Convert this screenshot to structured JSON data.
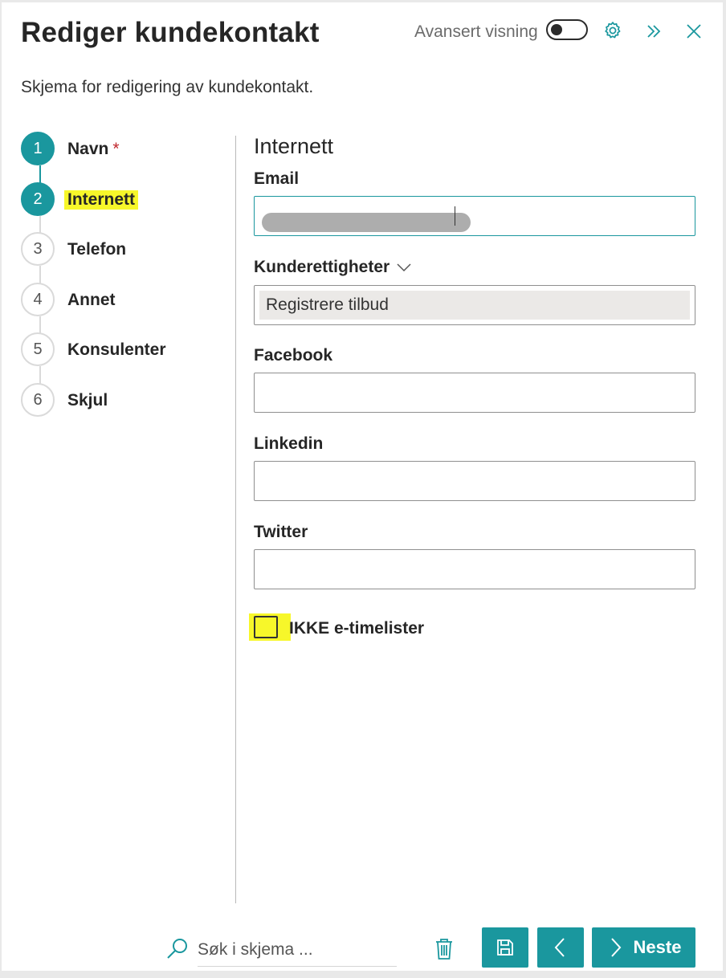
{
  "header": {
    "title": "Rediger kundekontakt",
    "advanced_view_label": "Avansert visning",
    "advanced_view_on": false,
    "subtitle": "Skjema for redigering av kundekontakt."
  },
  "steps": [
    {
      "number": "1",
      "label": "Navn",
      "required_mark": "*",
      "state": "completed"
    },
    {
      "number": "2",
      "label": "Internett",
      "state": "active"
    },
    {
      "number": "3",
      "label": "Telefon",
      "state": "pending"
    },
    {
      "number": "4",
      "label": "Annet",
      "state": "pending"
    },
    {
      "number": "5",
      "label": "Konsulenter",
      "state": "pending"
    },
    {
      "number": "6",
      "label": "Skjul",
      "state": "pending"
    }
  ],
  "form": {
    "section_title": "Internett",
    "email": {
      "label": "Email",
      "value": ""
    },
    "rights": {
      "label": "Kunderettigheter",
      "selected": "Registrere tilbud"
    },
    "facebook": {
      "label": "Facebook",
      "value": ""
    },
    "linkedin": {
      "label": "Linkedin",
      "value": ""
    },
    "twitter": {
      "label": "Twitter",
      "value": ""
    },
    "no_timesheets": {
      "label": "IKKE e-timelister",
      "checked": false
    }
  },
  "footer": {
    "search_placeholder": "Søk i skjema ...",
    "next_label": "Neste"
  },
  "colors": {
    "accent": "#1a979e",
    "highlight": "#f7f72a",
    "required": "#c0272d"
  }
}
